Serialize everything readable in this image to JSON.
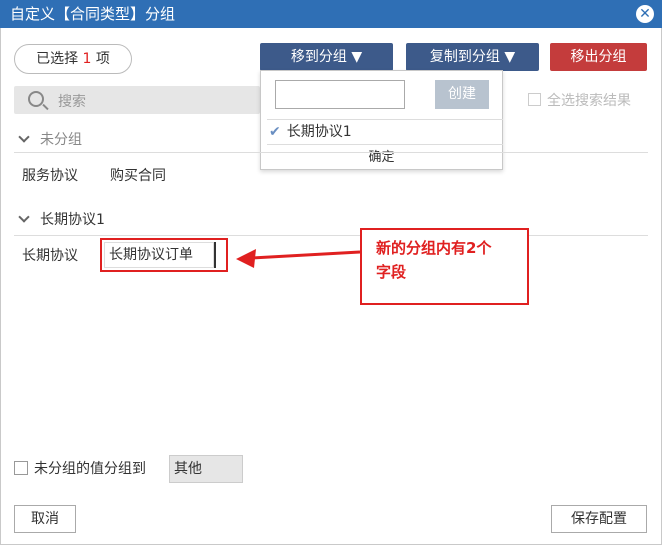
{
  "window": {
    "title": "自定义【合同类型】分组",
    "close_icon": "✕"
  },
  "toolbar": {
    "selected_prefix": "已选择",
    "selected_count": "1",
    "selected_suffix": "项",
    "move_to_group": "移到分组 ▼",
    "copy_to_group": "复制到分组 ▼",
    "remove_from_group": "移出分组"
  },
  "search": {
    "placeholder": "搜索",
    "select_all_label": "全选搜索结果"
  },
  "dropdown": {
    "create_label": "创建",
    "items": [
      {
        "label": "长期协议1",
        "checked": true
      }
    ],
    "confirm_label": "确定"
  },
  "groups": [
    {
      "name": "未分组",
      "fields": [
        "服务协议",
        "购买合同"
      ]
    },
    {
      "name": "长期协议1",
      "row_label": "长期协议",
      "fields": [
        "长期协议订单"
      ]
    }
  ],
  "annotation": {
    "text_line1": "新的分组内有2个",
    "text_line2": "字段"
  },
  "footer": {
    "ungrouped_label": "未分组的值分组到",
    "other_value": "其他",
    "cancel_label": "取消",
    "save_label": "保存配置"
  },
  "colors": {
    "titlebar": "#2f6fb5",
    "button_blue": "#3d5a8a",
    "button_red": "#c43c3c",
    "annotation": "#e02020"
  }
}
